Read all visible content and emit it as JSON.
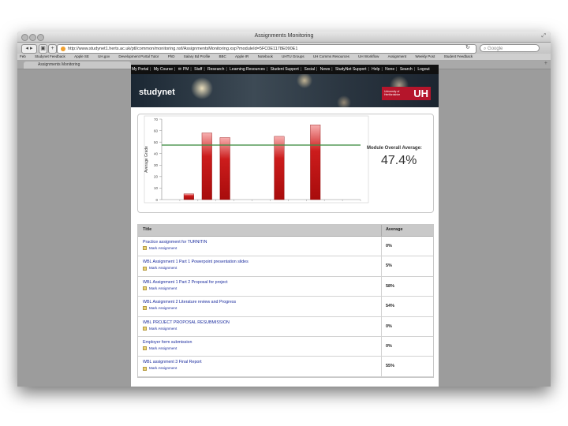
{
  "window": {
    "title": "Assignments Monitoring",
    "url": "http://www.studynet1.herts.ac.uk/ptl/common/monitoring.nsf/AssignmentsMonitoring.xsp?moduleId=5FC0E1178E090E1",
    "search_placeholder": "Google",
    "tab_label": "Assignments Monitoring"
  },
  "bookmarks": [
    "Feb",
    "Studynet Feedback",
    "Apple SE",
    "UH.gov",
    "Development Portal Tutor",
    "PhD",
    "Salary Bd Profile",
    "BBC",
    "Apple IR",
    "Notebook",
    "UHTU Groups",
    "UH Comms Resources",
    "UH Workflow",
    "Assignment",
    "Weekly Post",
    "Student Feedback"
  ],
  "portal_nav": {
    "items": [
      "My Portal",
      "My Course",
      "PM",
      "Staff",
      "Research",
      "Learning Resources",
      "Student Support",
      "Social",
      "News",
      "StudyNet Support",
      "Help",
      "None",
      "Search",
      "Logout"
    ]
  },
  "banner": {
    "logo": "studynet",
    "uh_small": "University of Hertfordshire",
    "uh_big": "UH"
  },
  "chart_data": {
    "type": "bar",
    "ylabel": "Average Grade",
    "ylim": [
      0,
      70
    ],
    "yticks": [
      0,
      10,
      20,
      30,
      40,
      50,
      60,
      70
    ],
    "categories": [
      "1",
      "2",
      "3",
      "4",
      "5",
      "6",
      "7",
      "8",
      "9",
      "10",
      "11"
    ],
    "values": [
      0,
      5,
      58,
      54,
      0,
      0,
      55,
      0,
      65,
      0,
      0
    ],
    "reference_line": 47.4,
    "colors": {
      "bar": "#cc1c1c",
      "line": "#3d8c40"
    }
  },
  "summary": {
    "label": "Module Overall Average:",
    "value": "47.4%"
  },
  "table": {
    "col_title": "Title",
    "col_average": "Average",
    "rows": [
      {
        "title": "Practice assignment for TURNITIN",
        "sub": "Mark Assignment",
        "average": "0%"
      },
      {
        "title": "WBL Assignment 1 Part 1 Powerpoint presentation slides",
        "sub": "Mark Assignment",
        "average": "5%"
      },
      {
        "title": "WBL Assignment 1 Part 2 Proposal for project",
        "sub": "Mark Assignment",
        "average": "58%"
      },
      {
        "title": "WBL Assignment 2 Literature review and Progress",
        "sub": "Mark Assignment",
        "average": "54%"
      },
      {
        "title": "WBL PROJECT PROPOSAL RESUBMISSION",
        "sub": "Mark Assignment",
        "average": "0%"
      },
      {
        "title": "Employer form submission",
        "sub": "Mark Assignment",
        "average": "0%"
      },
      {
        "title": "WBL assignment 3 Final Report",
        "sub": "Mark Assignment",
        "average": "55%"
      }
    ]
  }
}
